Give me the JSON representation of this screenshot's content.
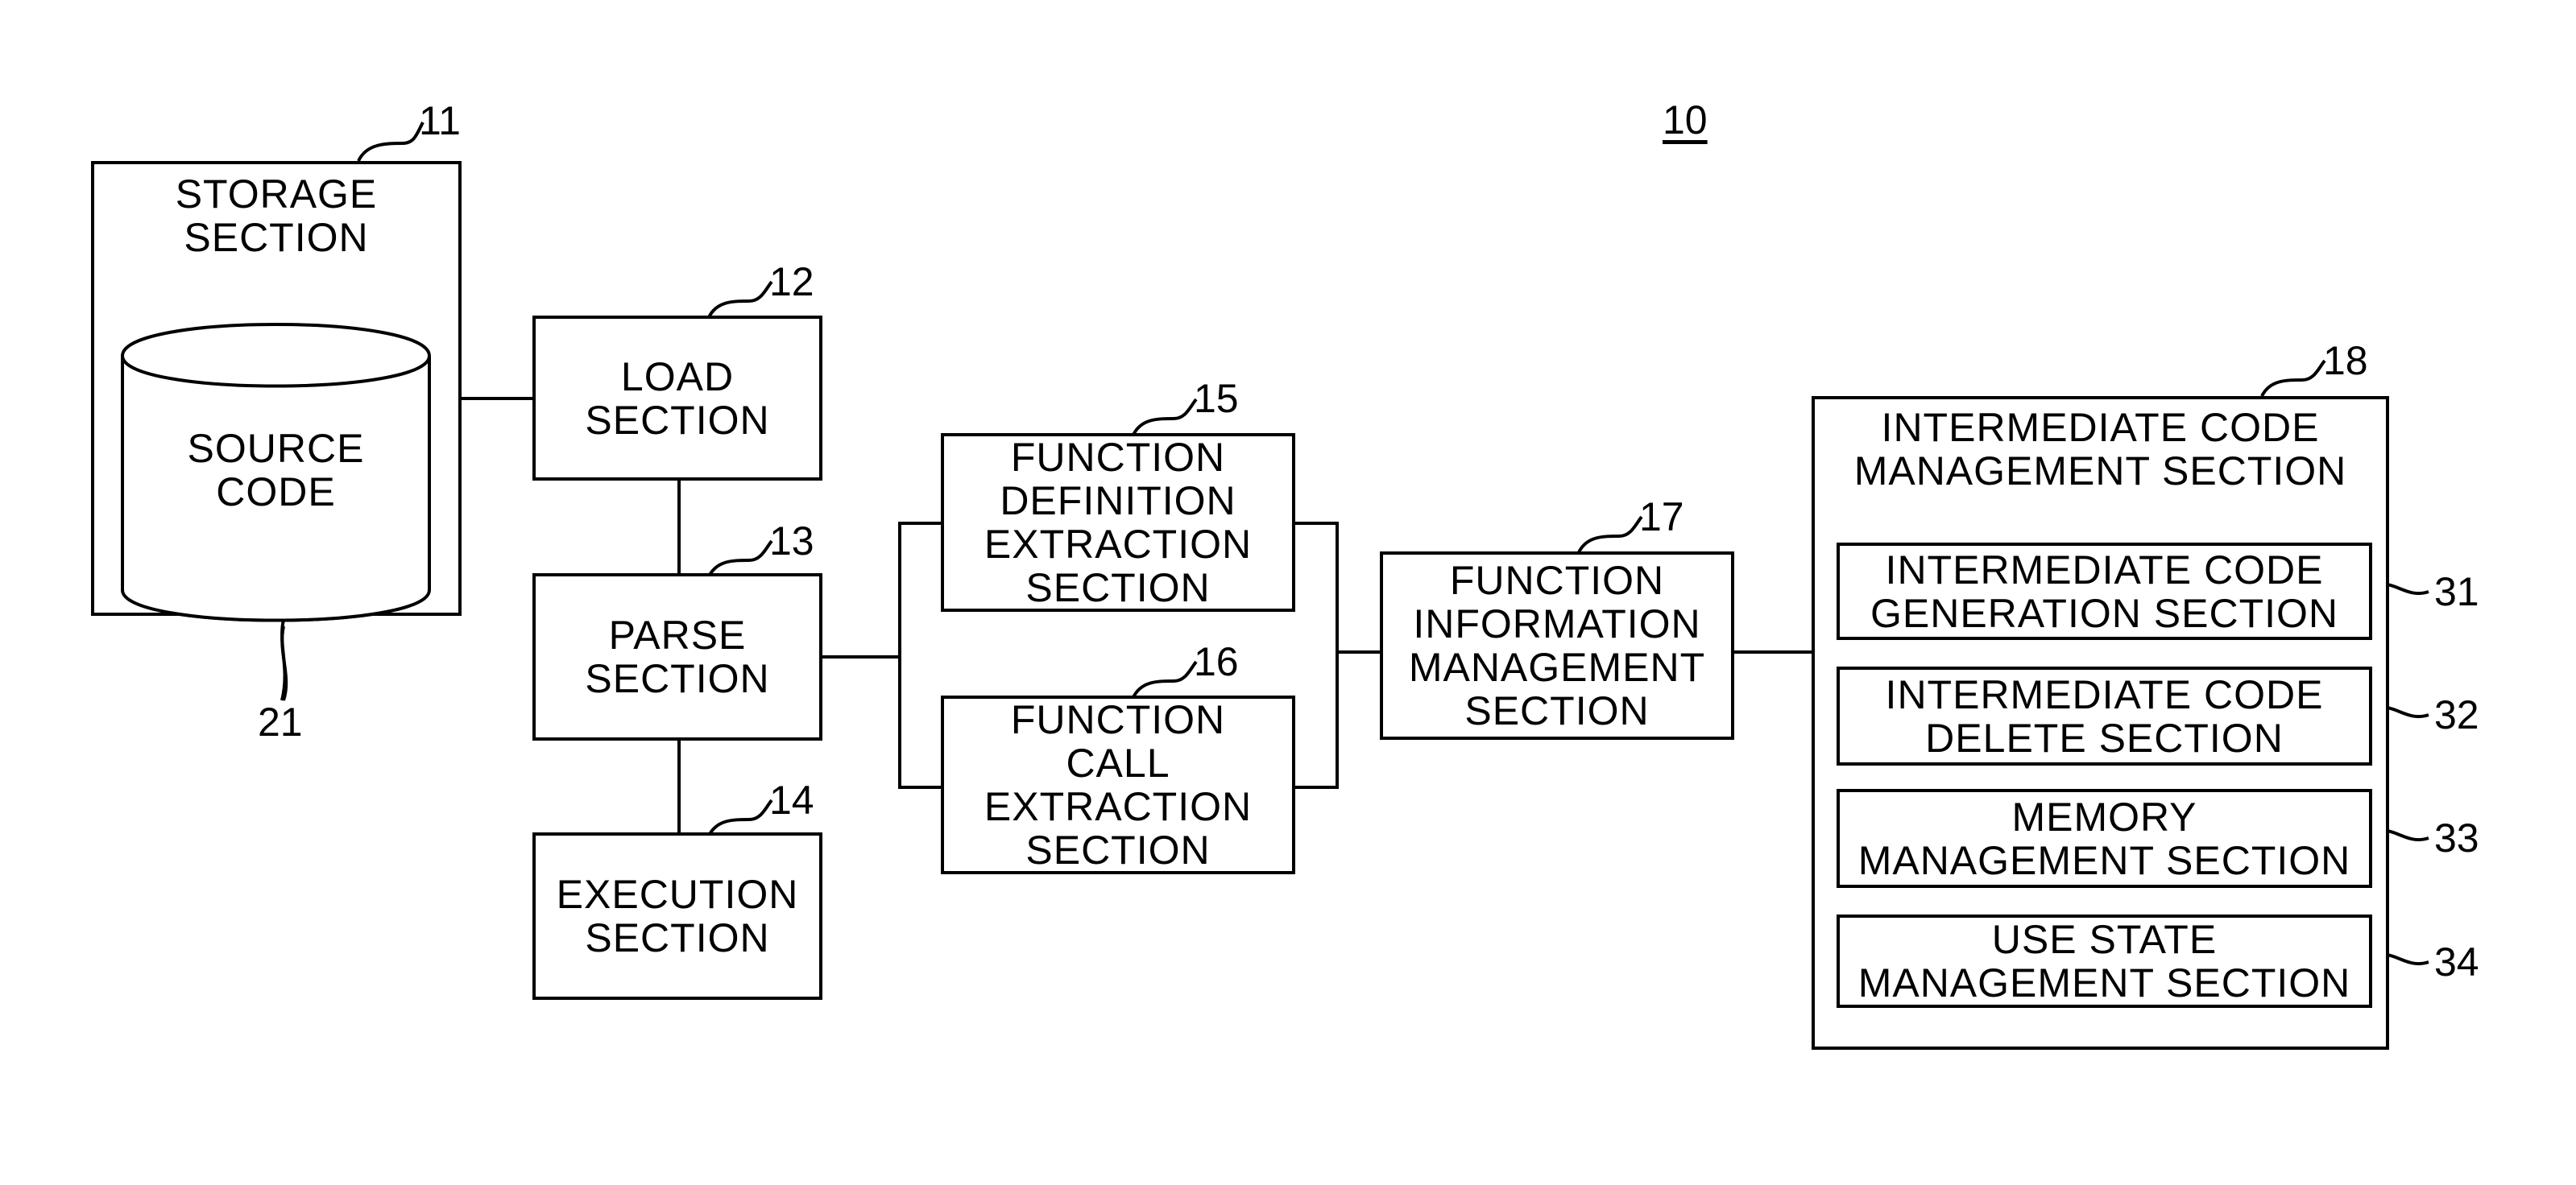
{
  "figure_number": "10",
  "blocks": {
    "storage": {
      "ref": "11",
      "label": "STORAGE\nSECTION"
    },
    "source_code": {
      "ref": "21",
      "label": "SOURCE\nCODE"
    },
    "load": {
      "ref": "12",
      "label": "LOAD\nSECTION"
    },
    "parse": {
      "ref": "13",
      "label": "PARSE\nSECTION"
    },
    "execution": {
      "ref": "14",
      "label": "EXECUTION\nSECTION"
    },
    "function_definition": {
      "ref": "15",
      "label": "FUNCTION\nDEFINITION\nEXTRACTION\nSECTION"
    },
    "function_call": {
      "ref": "16",
      "label": "FUNCTION\nCALL\nEXTRACTION\nSECTION"
    },
    "function_info": {
      "ref": "17",
      "label": "FUNCTION\nINFORMATION\nMANAGEMENT\nSECTION"
    },
    "intermediate_mgmt": {
      "ref": "18",
      "label": "INTERMEDIATE CODE\nMANAGEMENT SECTION",
      "sub": [
        {
          "ref": "31",
          "label": "INTERMEDIATE CODE\nGENERATION SECTION"
        },
        {
          "ref": "32",
          "label": "INTERMEDIATE CODE\nDELETE SECTION"
        },
        {
          "ref": "33",
          "label": "MEMORY\nMANAGEMENT SECTION"
        },
        {
          "ref": "34",
          "label": "USE STATE\nMANAGEMENT SECTION"
        }
      ]
    }
  }
}
